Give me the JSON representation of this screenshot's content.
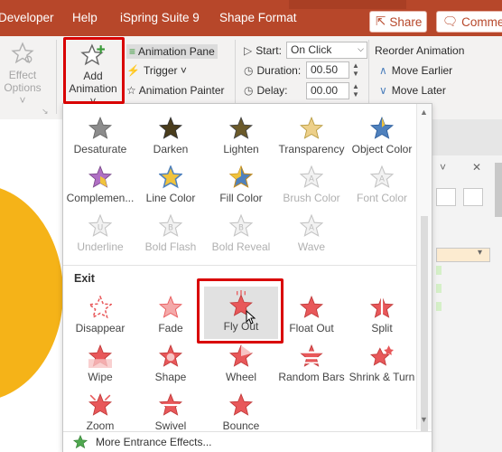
{
  "menubar": {
    "items": [
      "Developer",
      "Help",
      "iSpring Suite 9",
      "Shape Format"
    ],
    "share": "Share",
    "comments": "Commen"
  },
  "ribbon": {
    "effect_options": [
      "Effect",
      "Options ˅"
    ],
    "add_animation": [
      "Add",
      "Animation ˅"
    ],
    "animation_pane": "Animation Pane",
    "trigger": "Trigger ˅",
    "animation_painter": "Animation Painter",
    "start_label": "Start:",
    "start_value": "On Click",
    "duration_label": "Duration:",
    "duration_value": "00.50",
    "delay_label": "Delay:",
    "delay_value": "00.00",
    "reorder": "Reorder Animation",
    "move_earlier": "Move Earlier",
    "move_later": "Move Later"
  },
  "gallery": {
    "emphasis_rows": [
      [
        {
          "label": "Desaturate",
          "enabled": true,
          "color": "#8c8c8c"
        },
        {
          "label": "Darken",
          "enabled": true,
          "color": "#5a4a1a"
        },
        {
          "label": "Lighten",
          "enabled": true,
          "color": "#6b5a2a"
        },
        {
          "label": "Transparency",
          "enabled": true,
          "color": "#e8c46a"
        },
        {
          "label": "Object Color",
          "enabled": true,
          "color": "#4f81bd"
        }
      ],
      [
        {
          "label": "Complemen...",
          "enabled": true,
          "color": "#b06fc4"
        },
        {
          "label": "Line Color",
          "enabled": true,
          "color": "#f0c33c"
        },
        {
          "label": "Fill Color",
          "enabled": true,
          "color": "#4f81bd"
        },
        {
          "label": "Brush Color",
          "enabled": false,
          "color": "#d0d0d0"
        },
        {
          "label": "Font Color",
          "enabled": false,
          "color": "#d0d0d0"
        }
      ],
      [
        {
          "label": "Underline",
          "enabled": false,
          "color": "#d0d0d0"
        },
        {
          "label": "Bold Flash",
          "enabled": false,
          "color": "#d0d0d0"
        },
        {
          "label": "Bold Reveal",
          "enabled": false,
          "color": "#d0d0d0"
        },
        {
          "label": "Wave",
          "enabled": false,
          "color": "#d0d0d0"
        }
      ]
    ],
    "exit_heading": "Exit",
    "exit_rows": [
      [
        {
          "label": "Disappear",
          "enabled": true,
          "color": "#e8585a"
        },
        {
          "label": "Fade",
          "enabled": true,
          "color": "#e8585a"
        },
        {
          "label": "Fly Out",
          "enabled": true,
          "color": "#e8585a"
        },
        {
          "label": "Float Out",
          "enabled": true,
          "color": "#e8585a"
        },
        {
          "label": "Split",
          "enabled": true,
          "color": "#e8585a"
        }
      ],
      [
        {
          "label": "Wipe",
          "enabled": true,
          "color": "#e8585a"
        },
        {
          "label": "Shape",
          "enabled": true,
          "color": "#e8585a"
        },
        {
          "label": "Wheel",
          "enabled": true,
          "color": "#e8585a"
        },
        {
          "label": "Random Bars",
          "enabled": true,
          "color": "#e8585a"
        },
        {
          "label": "Shrink & Turn",
          "enabled": true,
          "color": "#e8585a"
        }
      ],
      [
        {
          "label": "Zoom",
          "enabled": true,
          "color": "#e8585a"
        },
        {
          "label": "Swivel",
          "enabled": true,
          "color": "#e8585a"
        },
        {
          "label": "Bounce",
          "enabled": true,
          "color": "#e8585a"
        }
      ]
    ],
    "more_entrance": "More Entrance Effects..."
  },
  "colors": {
    "brand": "#b7472a",
    "highlight": "#d90000",
    "slide_shape": "#f5b318",
    "exit_star": "#e8585a"
  }
}
